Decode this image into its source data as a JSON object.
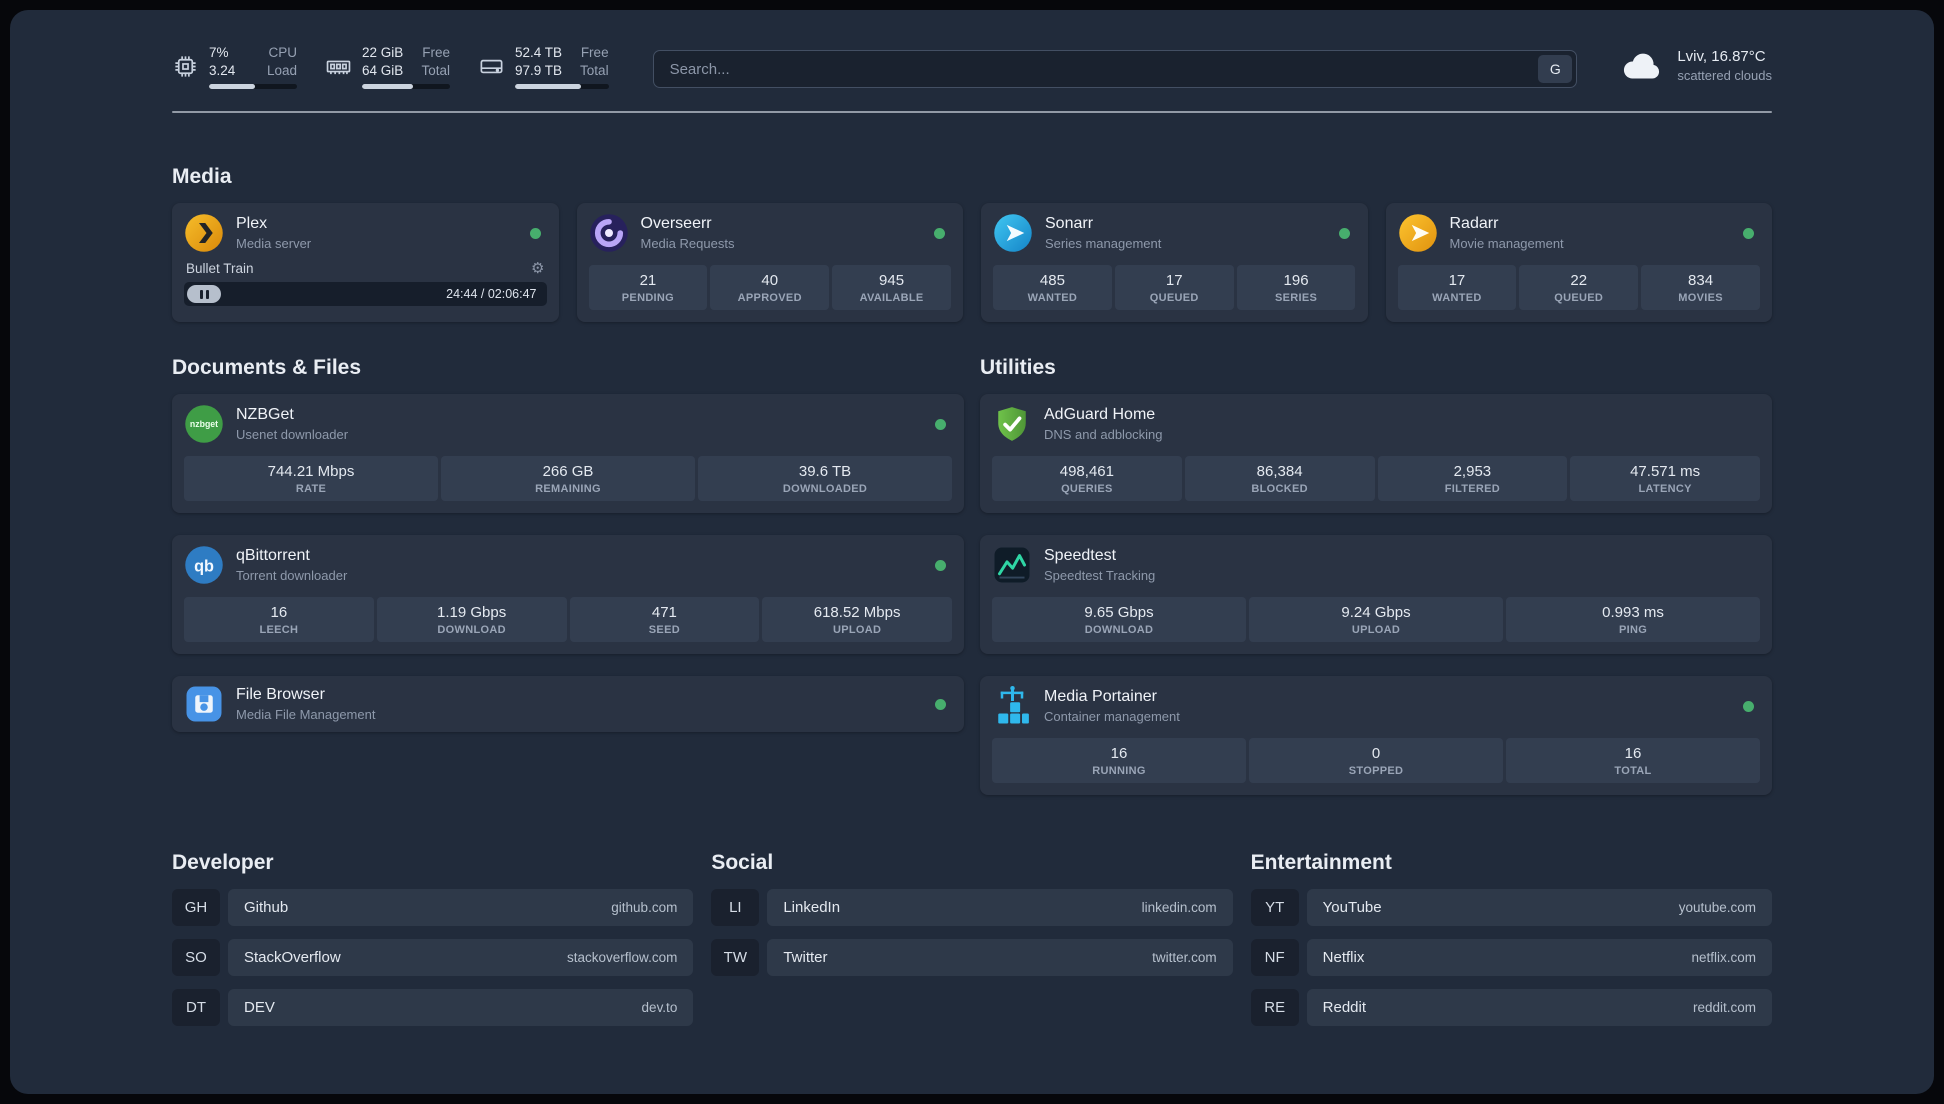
{
  "header": {
    "resources": {
      "cpu": {
        "icon": "cpu-icon",
        "value1": "7%",
        "label1": "CPU",
        "value2": "3.24",
        "label2": "Load",
        "percent": 52
      },
      "memory": {
        "icon": "memory-icon",
        "value1": "22 GiB",
        "label1": "Free",
        "value2": "64 GiB",
        "label2": "Total",
        "percent": 58
      },
      "disk": {
        "icon": "disk-icon",
        "value1": "52.4 TB",
        "label1": "Free",
        "value2": "97.9 TB",
        "label2": "Total",
        "percent": 70
      }
    },
    "search": {
      "placeholder": "Search...",
      "button_label": "G"
    },
    "weather": {
      "icon": "cloud-icon",
      "location": "Lviv, 16.87°C",
      "condition": "scattered clouds"
    }
  },
  "groups": {
    "media": {
      "title": "Media",
      "plex": {
        "icon": "plex-icon",
        "name": "Plex",
        "subtitle": "Media server",
        "online": true,
        "player": {
          "title": "Bullet Train",
          "time": "24:44 / 02:06:47",
          "state": "playing"
        }
      },
      "overseerr": {
        "icon": "overseerr-icon",
        "name": "Overseerr",
        "subtitle": "Media Requests",
        "online": true,
        "stats": [
          {
            "value": "21",
            "label": "PENDING"
          },
          {
            "value": "40",
            "label": "APPROVED"
          },
          {
            "value": "945",
            "label": "AVAILABLE"
          }
        ]
      },
      "sonarr": {
        "icon": "sonarr-icon",
        "name": "Sonarr",
        "subtitle": "Series management",
        "online": true,
        "stats": [
          {
            "value": "485",
            "label": "WANTED"
          },
          {
            "value": "17",
            "label": "QUEUED"
          },
          {
            "value": "196",
            "label": "SERIES"
          }
        ]
      },
      "radarr": {
        "icon": "radarr-icon",
        "name": "Radarr",
        "subtitle": "Movie management",
        "online": true,
        "stats": [
          {
            "value": "17",
            "label": "WANTED"
          },
          {
            "value": "22",
            "label": "QUEUED"
          },
          {
            "value": "834",
            "label": "MOVIES"
          }
        ]
      }
    },
    "documents": {
      "title": "Documents & Files",
      "nzbget": {
        "icon": "nzbget-icon",
        "name": "NZBGet",
        "subtitle": "Usenet downloader",
        "online": true,
        "stats": [
          {
            "value": "744.21 Mbps",
            "label": "RATE"
          },
          {
            "value": "266 GB",
            "label": "REMAINING"
          },
          {
            "value": "39.6 TB",
            "label": "DOWNLOADED"
          }
        ]
      },
      "qbittorrent": {
        "icon": "qbittorrent-icon",
        "name": "qBittorrent",
        "subtitle": "Torrent downloader",
        "online": true,
        "stats": [
          {
            "value": "16",
            "label": "LEECH"
          },
          {
            "value": "1.19 Gbps",
            "label": "DOWNLOAD"
          },
          {
            "value": "471",
            "label": "SEED"
          },
          {
            "value": "618.52 Mbps",
            "label": "UPLOAD"
          }
        ]
      },
      "filebrowser": {
        "icon": "filebrowser-icon",
        "name": "File Browser",
        "subtitle": "Media File Management",
        "online": true
      }
    },
    "utilities": {
      "title": "Utilities",
      "adguard": {
        "icon": "adguard-icon",
        "name": "AdGuard Home",
        "subtitle": "DNS and adblocking",
        "online": false,
        "stats": [
          {
            "value": "498,461",
            "label": "QUERIES"
          },
          {
            "value": "86,384",
            "label": "BLOCKED"
          },
          {
            "value": "2,953",
            "label": "FILTERED"
          },
          {
            "value": "47.571 ms",
            "label": "LATENCY"
          }
        ]
      },
      "speedtest": {
        "icon": "speedtest-icon",
        "name": "Speedtest",
        "subtitle": "Speedtest Tracking",
        "online": false,
        "stats": [
          {
            "value": "9.65 Gbps",
            "label": "DOWNLOAD"
          },
          {
            "value": "9.24 Gbps",
            "label": "UPLOAD"
          },
          {
            "value": "0.993 ms",
            "label": "PING"
          }
        ]
      },
      "portainer": {
        "icon": "portainer-icon",
        "name": "Media Portainer",
        "subtitle": "Container management",
        "online": true,
        "stats": [
          {
            "value": "16",
            "label": "RUNNING"
          },
          {
            "value": "0",
            "label": "STOPPED"
          },
          {
            "value": "16",
            "label": "TOTAL"
          }
        ]
      }
    }
  },
  "bookmarks": {
    "developer": {
      "title": "Developer",
      "items": [
        {
          "abbr": "GH",
          "name": "Github",
          "url": "github.com"
        },
        {
          "abbr": "SO",
          "name": "StackOverflow",
          "url": "stackoverflow.com"
        },
        {
          "abbr": "DT",
          "name": "DEV",
          "url": "dev.to"
        }
      ]
    },
    "social": {
      "title": "Social",
      "items": [
        {
          "abbr": "LI",
          "name": "LinkedIn",
          "url": "linkedin.com"
        },
        {
          "abbr": "TW",
          "name": "Twitter",
          "url": "twitter.com"
        }
      ]
    },
    "entertainment": {
      "title": "Entertainment",
      "items": [
        {
          "abbr": "YT",
          "name": "YouTube",
          "url": "youtube.com"
        },
        {
          "abbr": "NF",
          "name": "Netflix",
          "url": "netflix.com"
        },
        {
          "abbr": "RE",
          "name": "Reddit",
          "url": "reddit.com"
        }
      ]
    }
  },
  "colors": {
    "status_online": "#47ae6d",
    "panel_bg": "#212b3b",
    "card_bg": "#2a3343",
    "stat_tile_bg": "#333e50",
    "accent_bar_fill": "#ccd4df"
  }
}
